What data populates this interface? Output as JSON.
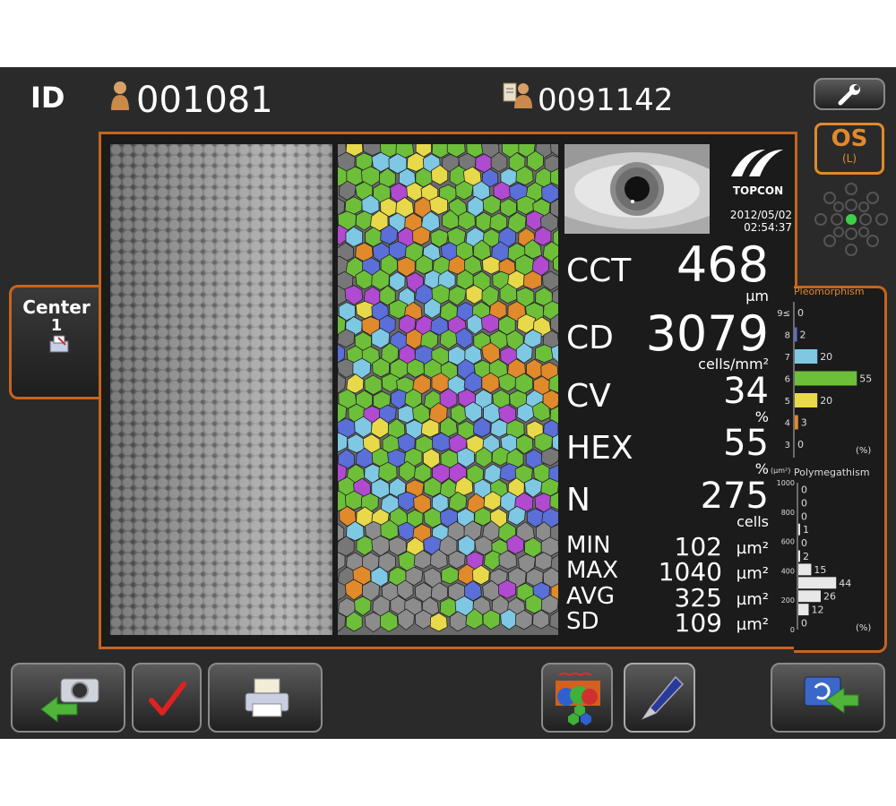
{
  "header": {
    "id_label": "ID",
    "patient_id": "001081",
    "exam_id": "0091142"
  },
  "eye": {
    "side": "OS",
    "side_sub": "(L)"
  },
  "position": {
    "label": "Center",
    "number": "1"
  },
  "brand": {
    "name": "TOPCON",
    "date": "2012/05/02",
    "time": "02:54:37"
  },
  "metrics": {
    "cct": {
      "label": "CCT",
      "value": "468",
      "unit": "µm"
    },
    "cd": {
      "label": "CD",
      "value": "3079",
      "unit": "cells/mm²"
    },
    "cv": {
      "label": "CV",
      "value": "34",
      "unit": "%"
    },
    "hex": {
      "label": "HEX",
      "value": "55",
      "unit": "%"
    },
    "n": {
      "label": "N",
      "value": "275",
      "unit": "cells"
    },
    "min": {
      "label": "MIN",
      "value": "102",
      "unit": "µm²"
    },
    "max": {
      "label": "MAX",
      "value": "1040",
      "unit": "µm²"
    },
    "avg": {
      "label": "AVG",
      "value": "325",
      "unit": "µm²"
    },
    "sd": {
      "label": "SD",
      "value": "109",
      "unit": "µm²"
    }
  },
  "pleomorphism": {
    "title": "Pleomorphism",
    "pct_label": "(%)",
    "bars": [
      {
        "label": "9≤",
        "value": 0,
        "color": "#ffffff"
      },
      {
        "label": "8",
        "value": 2,
        "color": "#5a6fd8"
      },
      {
        "label": "7",
        "value": 20,
        "color": "#7ec8e3"
      },
      {
        "label": "6",
        "value": 55,
        "color": "#6dbf3a"
      },
      {
        "label": "5",
        "value": 20,
        "color": "#e7d94a"
      },
      {
        "label": "4",
        "value": 3,
        "color": "#e08a2c"
      },
      {
        "label": "3",
        "value": 0,
        "color": "#ffffff"
      }
    ]
  },
  "polymegathism": {
    "title": "Polymegathism",
    "unit_label": "(µm²)",
    "pct_label": "(%)",
    "axis_ticks": [
      "1000",
      "800",
      "600",
      "400",
      "200",
      "0"
    ],
    "bars": [
      {
        "value": 0
      },
      {
        "value": 0
      },
      {
        "value": 0
      },
      {
        "value": 1
      },
      {
        "value": 0
      },
      {
        "value": 2
      },
      {
        "value": 15
      },
      {
        "value": 44
      },
      {
        "value": 26
      },
      {
        "value": 12
      },
      {
        "value": 0
      }
    ]
  }
}
